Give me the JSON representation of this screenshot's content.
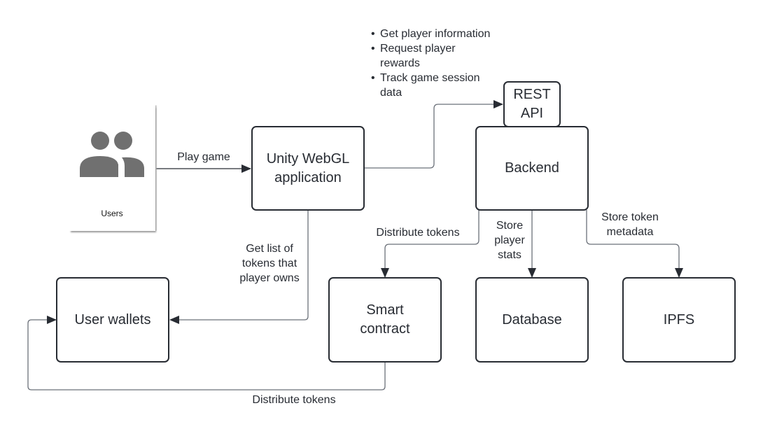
{
  "diagram": {
    "type": "architecture-flow",
    "nodes": {
      "users": {
        "label": "Users",
        "icon": "users-icon"
      },
      "unity_app": {
        "label": "Unity WebGL\napplication"
      },
      "rest_api": {
        "label": "REST\nAPI"
      },
      "backend": {
        "label": "Backend"
      },
      "user_wallets": {
        "label": "User wallets"
      },
      "smart_contract": {
        "label": "Smart\ncontract"
      },
      "database": {
        "label": "Database"
      },
      "ipfs": {
        "label": "IPFS"
      }
    },
    "api_notes": [
      "Get player information",
      "Request player\nrewards",
      "Track game session\ndata"
    ],
    "edges": [
      {
        "from": "Users",
        "to": "Unity WebGL application",
        "label": "Play game"
      },
      {
        "from": "Unity WebGL application",
        "to": "REST API",
        "label": ""
      },
      {
        "from": "Unity WebGL application",
        "to": "User wallets",
        "label": "Get list of\ntokens that\nplayer owns"
      },
      {
        "from": "Backend",
        "to": "Smart contract",
        "label": "Distribute tokens"
      },
      {
        "from": "Backend",
        "to": "Database",
        "label": "Store\nplayer\nstats"
      },
      {
        "from": "Backend",
        "to": "IPFS",
        "label": "Store token\nmetadata"
      },
      {
        "from": "Smart contract",
        "to": "User wallets",
        "label": "Distribute tokens"
      }
    ]
  },
  "colors": {
    "stroke": "#282c33",
    "connector": "#6b7079",
    "icon": "#707070"
  }
}
